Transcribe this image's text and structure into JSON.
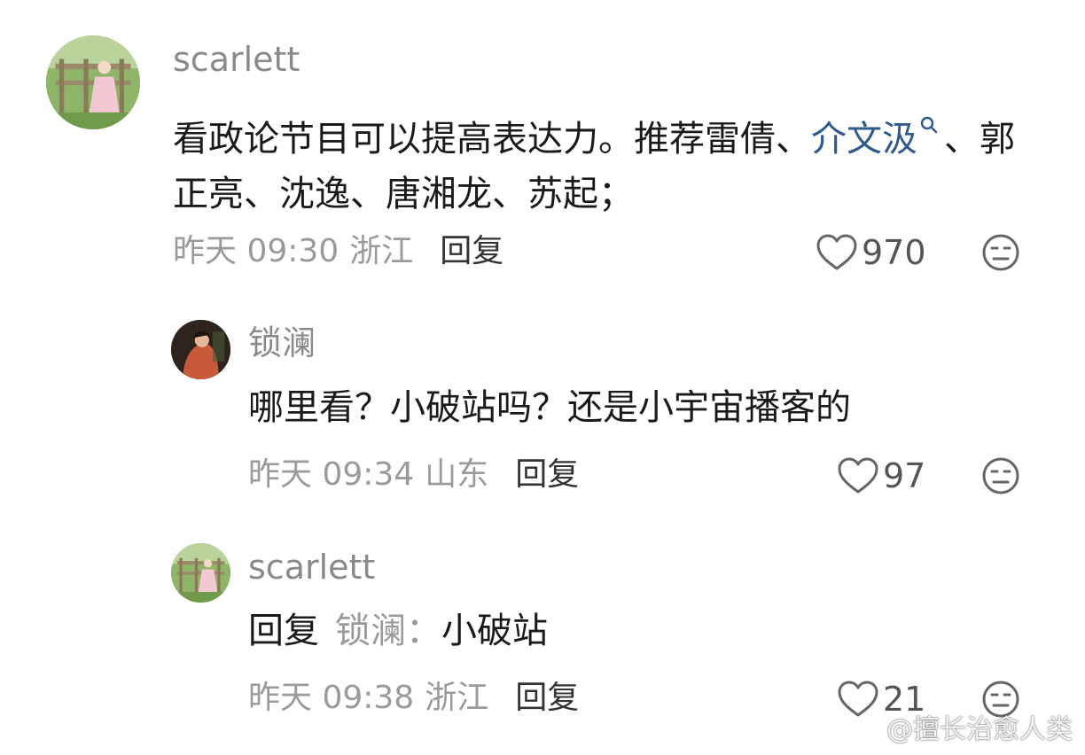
{
  "comments": [
    {
      "username": "scarlett",
      "text_before": "看政论节目可以提高表达力。推荐雷倩、",
      "mention": "介文汲",
      "text_after": "、郭正亮、沈逸、唐湘龙、苏起；",
      "date": "昨天",
      "time": "09:30",
      "location": "浙江",
      "reply_label": "回复",
      "likes": "970"
    },
    {
      "username": "锁澜",
      "text": "哪里看？小破站吗？还是小宇宙播客的",
      "date": "昨天",
      "time": "09:34",
      "location": "山东",
      "reply_label": "回复",
      "likes": "97"
    },
    {
      "username": "scarlett",
      "reply_prefix": "回复",
      "reply_target": "锁澜：",
      "text": "小破站",
      "date": "昨天",
      "time": "09:38",
      "location": "浙江",
      "reply_label": "回复",
      "likes": "21"
    }
  ],
  "icons": {
    "like": "heart-outline-icon",
    "dislike": "neutral-face-icon",
    "search_mark": "search-icon"
  },
  "colors": {
    "mention": "#2e5a8c",
    "muted": "#9a9a9a",
    "text": "#1a1a1a"
  },
  "watermark": "@擅长治愈人类"
}
